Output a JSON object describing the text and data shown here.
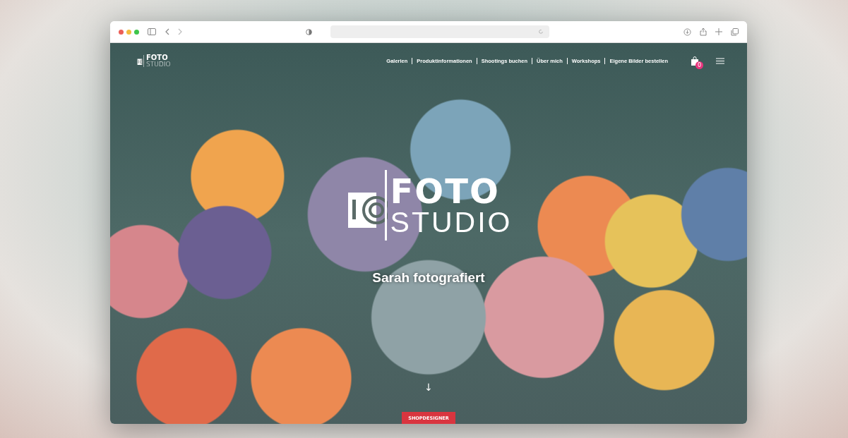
{
  "header": {
    "logo": {
      "top": "FOTO",
      "bottom": "STUDIO"
    },
    "nav": [
      "Galerien",
      "Produktinformationen",
      "Shootings buchen",
      "Über mich",
      "Workshops",
      "Eigene Bilder bestellen"
    ],
    "cart_count": "0"
  },
  "hero": {
    "logo": {
      "top": "FOTO",
      "bottom": "STUDIO"
    },
    "tagline": "Sarah fotografiert",
    "scroll_arrow": "↓"
  },
  "footer_badge": "SHOPDESIGNER"
}
